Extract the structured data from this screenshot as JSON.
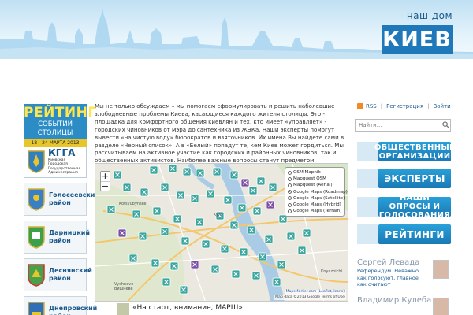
{
  "header": {
    "logo_small": "наш дом",
    "logo_big": "КИЕВ"
  },
  "left": {
    "rating": {
      "title": "РЕЙТИНГ",
      "subtitle": "СОБЫТИЙ СТОЛИЦЫ",
      "date": "18 - 24 МАРТА 2013"
    },
    "gov": {
      "big": "КГГА",
      "small": "Киевская Городская Государственная Администрация"
    },
    "districts": [
      "Голосеевский район",
      "Дарницкий район",
      "Деснянский район",
      "Днепровский район"
    ]
  },
  "main": {
    "intro": "Мы не только обсуждаем – мы помогаем сформулировать и решить наболевшие злободневные проблемы Киева, касающиеся каждого жителя столицы. Это - площадка для комфортного общения киевлян и тех, кто имеет «управляет» - городских чиновников от мэра до сантехника из ЖЭКа. Наши эксперты помогут вывести «на чистую воду» бюрократов и взяточников. Их имена Вы найдете сами в разделе «Черный список». А в «Белый» попадут те, кем Киев может гордиться. Мы рассчитываем на активное участие как городских и районных чиновников, так и общественных активистов. Наиболее важные вопросы станут предметом обсуждения на общегородском референдуме.",
    "map": {
      "zoom_in": "+",
      "zoom_out": "−",
      "layers": [
        "OSM Mapnik",
        "Mapquest OSM",
        "Mapquest (Aerial)",
        "Google Maps (Roadmap)",
        "Google Maps (Satellite)",
        "Google Maps (Hybrid)",
        "Google Maps (Terrain)"
      ],
      "selected_layer": "Google Maps (Roadmap)",
      "attribution_link": "MapsMarker.com (Leaflet, Icons)",
      "attribution": "Map data ©2013 Google  Terms of Use",
      "place_labels": [
        "Kotsyubynske",
        "Vyshneve",
        "Вишневе",
        "Kyiv",
        "Knyazhichi"
      ]
    },
    "post_title": "«На старт, внимание, МАРШ»."
  },
  "right": {
    "links": [
      "RSS",
      "Регистрация",
      "Войти"
    ],
    "search_placeholder": "Найти...",
    "buttons": [
      "ОБЩЕСТВЕННЫЕ ОРГАНИЗАЦИИ",
      "ЭКСПЕРТЫ",
      "НАШИ ОПРОСЫ И ГОЛОСОВАНИЯ",
      "РЕЙТИНГИ"
    ],
    "people": [
      {
        "name": "Сергей Левада",
        "quote": "Референдум. Неважно как голосуют, главное как считают"
      },
      {
        "name": "Владимир Кулеба",
        "quote": ""
      }
    ]
  },
  "colors": {
    "accent": "#1e78b9",
    "marker": "#3aa6a0",
    "marker_alt": "#7b4fa8",
    "button": "#1a8cc8"
  }
}
